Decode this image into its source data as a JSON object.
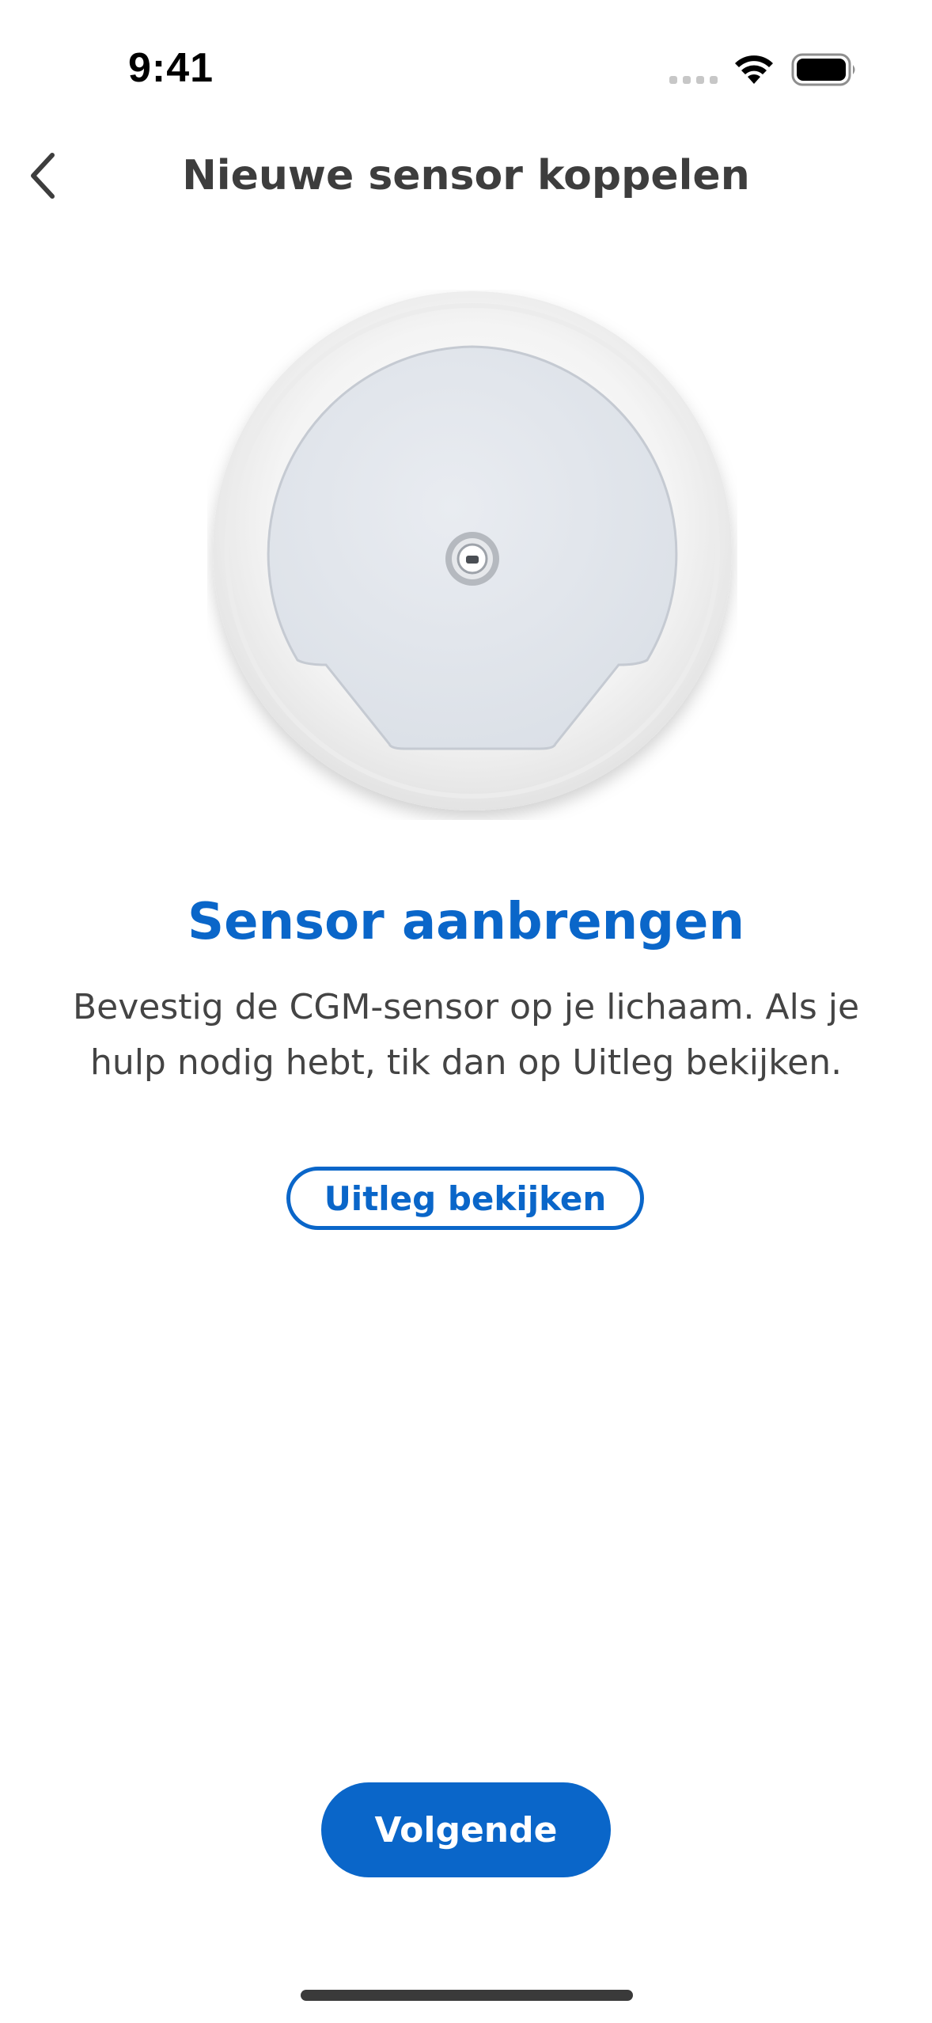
{
  "status_bar": {
    "time": "9:41"
  },
  "nav": {
    "title": "Nieuwe sensor koppelen",
    "back_icon": "chevron-left-icon"
  },
  "illustration": {
    "name": "cgm-sensor-illustration"
  },
  "content": {
    "title": "Sensor aanbrengen",
    "body": "Bevestig de CGM-sensor op je lichaam. Als je hulp nodig hebt, tik dan op Uitleg bekijken.",
    "explain_button_label": "Uitleg bekijken"
  },
  "footer": {
    "next_button_label": "Volgende"
  },
  "colors": {
    "accent": "#0a66c9",
    "text": "#3d3d3d",
    "background": "#ffffff"
  }
}
